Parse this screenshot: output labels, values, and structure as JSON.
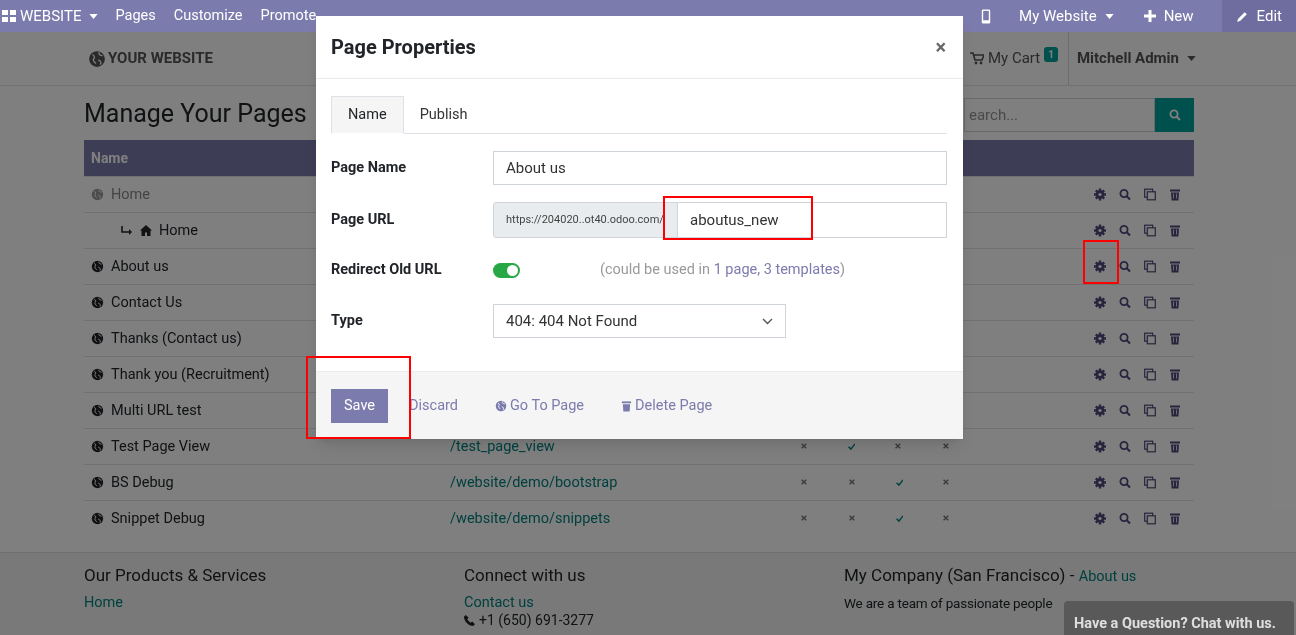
{
  "topbar": {
    "app_menu": "WEBSITE",
    "menus": [
      "Pages",
      "Customize",
      "Promote"
    ],
    "site_menu": "My Website",
    "new": "New",
    "edit": "Edit"
  },
  "site_header": {
    "logo": "YOUR WEBSITE",
    "cart": "My Cart",
    "cart_count": "1",
    "user": "Mitchell Admin"
  },
  "page_title": "Manage Your Pages",
  "search": {
    "placeholder": "earch..."
  },
  "table": {
    "columns": [
      "Name"
    ],
    "rows": [
      {
        "kind": "page",
        "name": "Home",
        "published": false
      },
      {
        "kind": "redirect",
        "name": "Home",
        "published": true
      },
      {
        "kind": "page",
        "name": "About us",
        "published": true
      },
      {
        "kind": "page",
        "name": "Contact Us",
        "published": true
      },
      {
        "kind": "page",
        "name": "Thanks (Contact us)",
        "published": true
      },
      {
        "kind": "page",
        "name": "Thank you (Recruitment)",
        "published": true
      },
      {
        "kind": "page",
        "name": "Multi URL test",
        "published": true
      },
      {
        "kind": "page",
        "name": "Test Page View",
        "published": true,
        "url": "/test_page_view",
        "flags": [
          false,
          true,
          false,
          false
        ]
      },
      {
        "kind": "page",
        "name": "BS Debug",
        "published": true,
        "url": "/website/demo/bootstrap",
        "flags": [
          false,
          false,
          true,
          false
        ]
      },
      {
        "kind": "page",
        "name": "Snippet Debug",
        "published": true,
        "url": "/website/demo/snippets",
        "flags": [
          false,
          false,
          true,
          false
        ]
      }
    ]
  },
  "modal": {
    "title": "Page Properties",
    "close": "×",
    "tabs": [
      {
        "label": "Name",
        "selected": true
      },
      {
        "label": "Publish",
        "selected": false
      }
    ],
    "page_name": {
      "label": "Page Name",
      "value": "About us"
    },
    "page_url": {
      "label": "Page URL",
      "prefix": "https://204020..ot40.odoo.com/",
      "value": "aboutus_new"
    },
    "redirect": {
      "label": "Redirect Old URL",
      "on": true,
      "note": "(could be used in ",
      "link": "1 page, 3 templates",
      "note_end": ")"
    },
    "type": {
      "label": "Type",
      "value": "404: 404 Not Found"
    },
    "buttons": [
      "Save",
      "Discard",
      "Go To Page",
      "Delete Page"
    ]
  },
  "footer": {
    "columns": [
      {
        "title": "Our Products & Services",
        "links": [
          "Home"
        ]
      },
      {
        "title": "Connect with us",
        "links": [
          "Contact us"
        ],
        "phone": "+1 (650) 691-3277"
      },
      {
        "title": "My Company (San Francisco)",
        "title_sep": " - ",
        "title_link": "About us",
        "text": "We are a team of passionate people"
      }
    ]
  },
  "chat": "Have a Question? Chat with us."
}
